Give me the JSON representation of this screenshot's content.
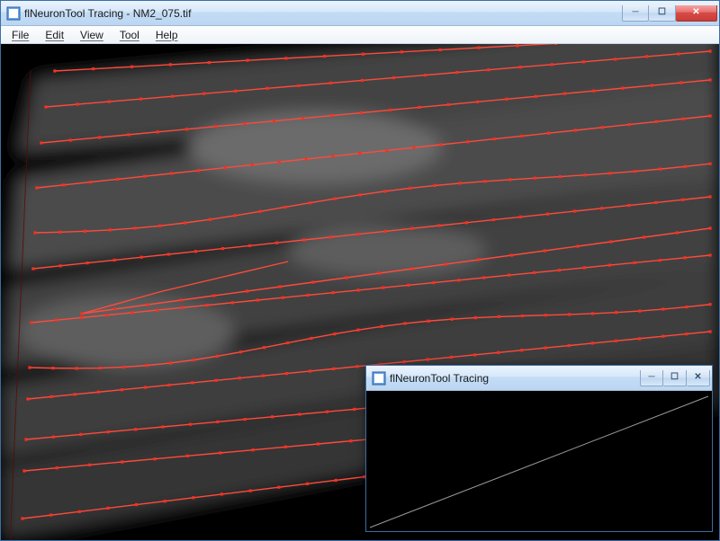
{
  "main_window": {
    "title": "flNeuronTool Tracing - NM2_075.tif",
    "controls": {
      "min": "—",
      "max": "☐",
      "close": "✕"
    }
  },
  "menubar": {
    "items": [
      "File",
      "Edit",
      "View",
      "Tool",
      "Help"
    ]
  },
  "child_window": {
    "title": "flNeuronTool Tracing",
    "controls": {
      "min": "—",
      "max": "☐",
      "close": "✕"
    }
  },
  "colors": {
    "trace": "#ff4a3c",
    "node": "#ff2e1f",
    "guide": "#5a0a0a",
    "profile": "#9a9a9a"
  }
}
